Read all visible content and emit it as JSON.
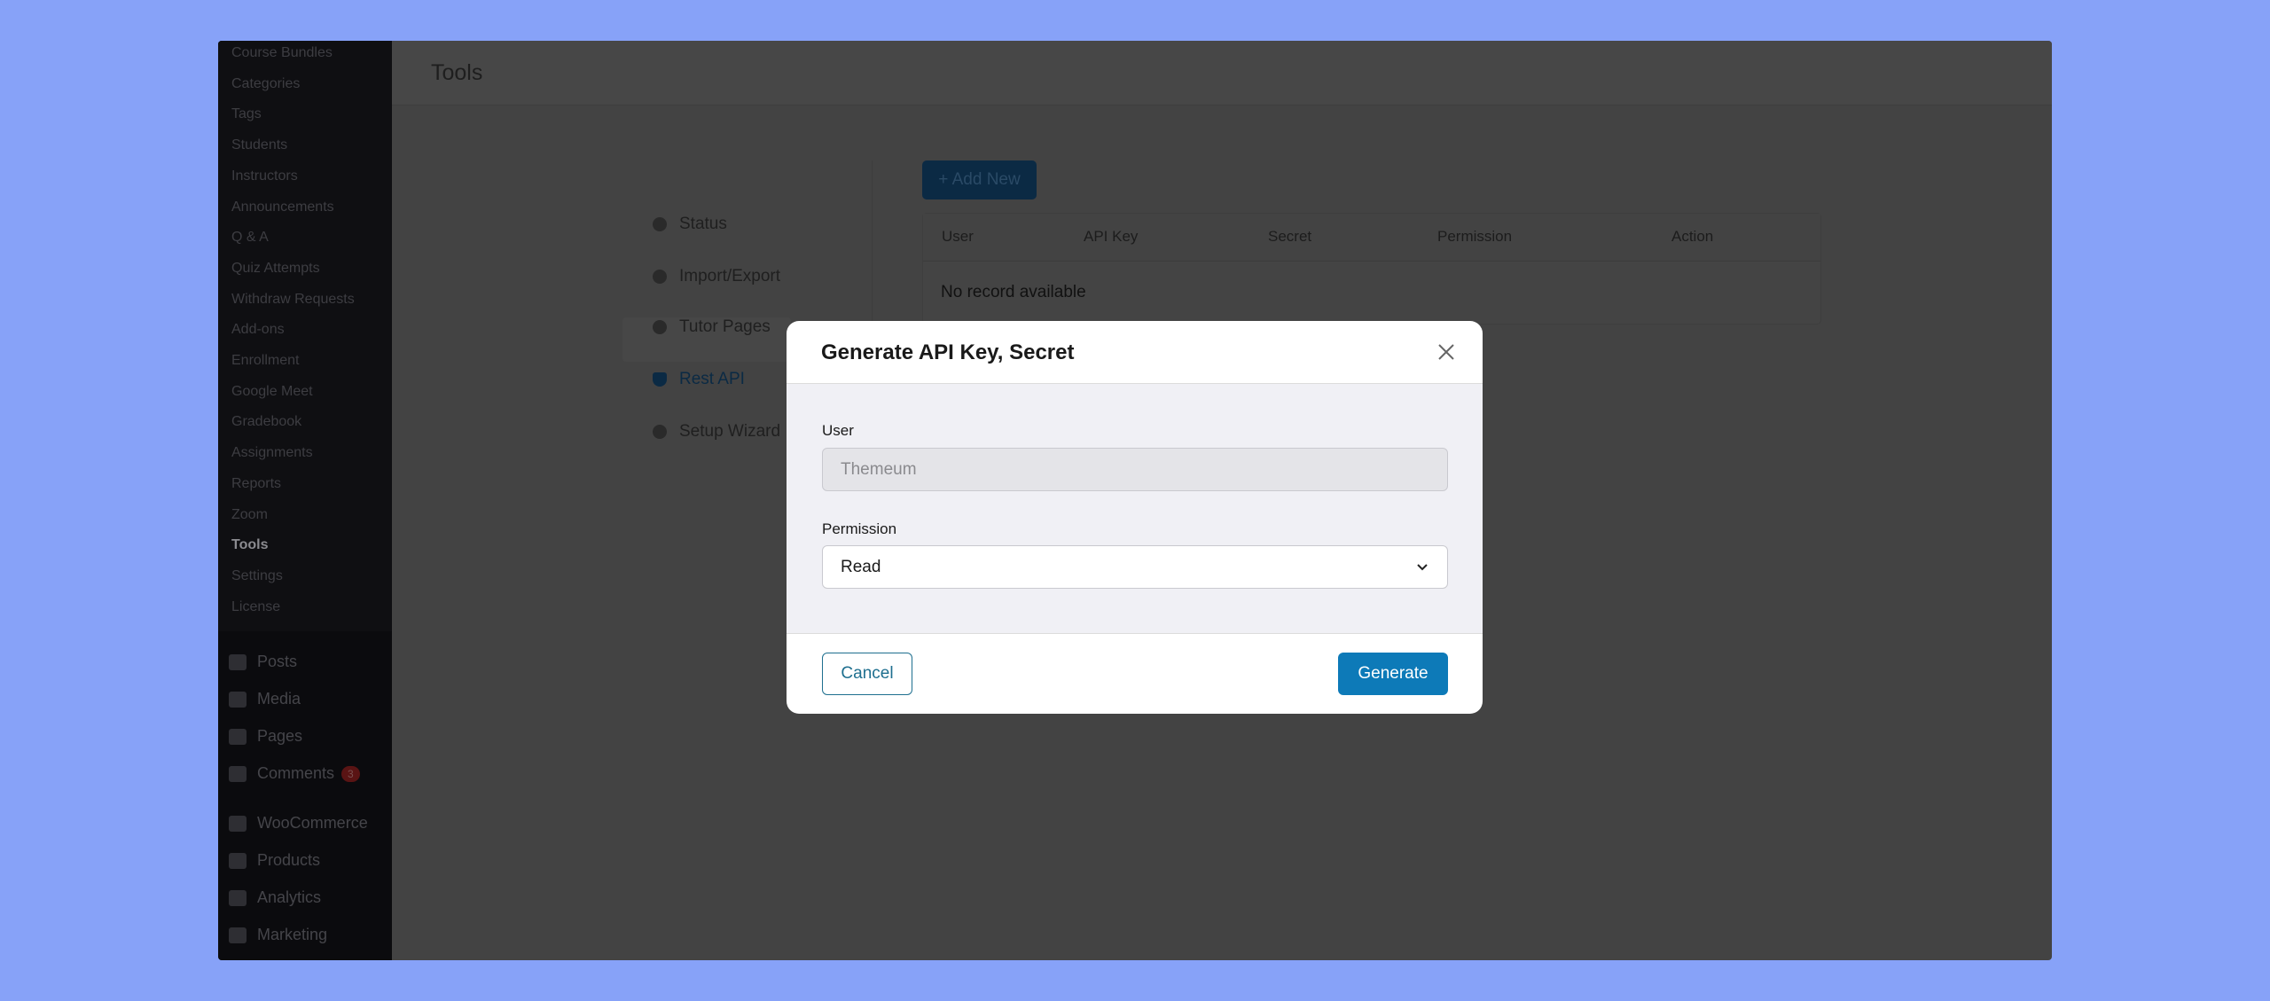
{
  "sidebar": {
    "sub_items": [
      "Course Bundles",
      "Categories",
      "Tags",
      "Students",
      "Instructors",
      "Announcements",
      "Q & A",
      "Quiz Attempts",
      "Withdraw Requests",
      "Add-ons",
      "Enrollment",
      "Google Meet",
      "Gradebook",
      "Assignments",
      "Reports",
      "Zoom",
      "Tools",
      "Settings",
      "License"
    ],
    "current": "Tools",
    "menu": [
      {
        "label": "Posts",
        "icon": "pin-icon"
      },
      {
        "label": "Media",
        "icon": "media-icon"
      },
      {
        "label": "Pages",
        "icon": "pages-icon"
      },
      {
        "label": "Comments",
        "icon": "comment-icon",
        "badge": "3"
      },
      {
        "label": "WooCommerce",
        "icon": "woo-icon"
      },
      {
        "label": "Products",
        "icon": "archive-icon"
      },
      {
        "label": "Analytics",
        "icon": "bar-chart-icon"
      },
      {
        "label": "Marketing",
        "icon": "megaphone-icon"
      }
    ]
  },
  "header": {
    "title": "Tools"
  },
  "tools_nav": [
    {
      "label": "Status",
      "icon": "pie-icon"
    },
    {
      "label": "Import/Export",
      "icon": "swap-icon"
    },
    {
      "label": "Tutor Pages",
      "icon": "pages-icon"
    },
    {
      "label": "Rest API",
      "icon": "shield-icon",
      "active": true
    },
    {
      "label": "Setup Wizard",
      "icon": "globe-icon"
    }
  ],
  "main": {
    "add_new": "+ Add New",
    "columns": [
      "User",
      "API Key",
      "Secret",
      "Permission",
      "Action"
    ],
    "empty": "No record available"
  },
  "modal": {
    "title": "Generate API Key, Secret",
    "user_label": "User",
    "user_value": "Themeum",
    "permission_label": "Permission",
    "permission_value": "Read",
    "cancel": "Cancel",
    "generate": "Generate"
  },
  "colors": {
    "primary": "#0d7ab8",
    "background": "#87a2f8"
  }
}
